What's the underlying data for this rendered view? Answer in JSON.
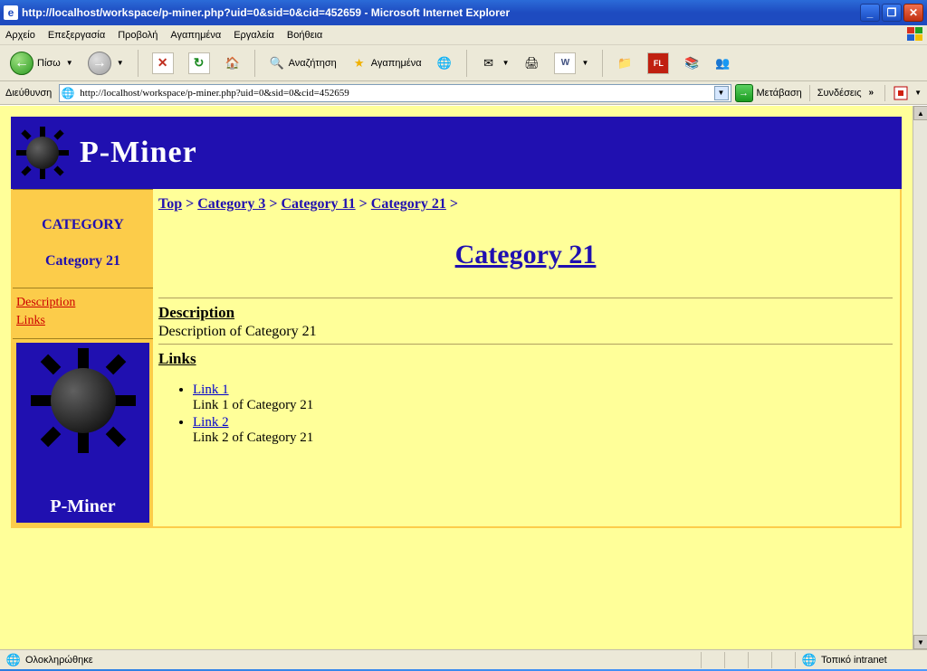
{
  "window": {
    "title": "http://localhost/workspace/p-miner.php?uid=0&sid=0&cid=452659 - Microsoft Internet Explorer"
  },
  "menu": {
    "items": [
      "Αρχείο",
      "Επεξεργασία",
      "Προβολή",
      "Αγαπημένα",
      "Εργαλεία",
      "Βοήθεια"
    ]
  },
  "toolbar": {
    "back_label": "Πίσω",
    "search_label": "Αναζήτηση",
    "favorites_label": "Αγαπημένα"
  },
  "address": {
    "label": "Διεύθυνση",
    "url": "http://localhost/workspace/p-miner.php?uid=0&sid=0&cid=452659",
    "go_label": "Μετάβαση",
    "links_label": "Συνδέσεις"
  },
  "page": {
    "brand": "P-Miner",
    "sidebar": {
      "category_label": "CATEGORY",
      "current_category": "Category 21",
      "nav": {
        "description": "Description",
        "links": "Links"
      },
      "footer_brand": "P-Miner"
    },
    "breadcrumb": {
      "items": [
        "Top",
        "Category 3",
        "Category 11",
        "Category 21"
      ],
      "sep": " > "
    },
    "heading": "Category 21",
    "description": {
      "title": "Description",
      "text": "Description of Category 21"
    },
    "links": {
      "title": "Links",
      "items": [
        {
          "label": "Link 1",
          "desc": "Link 1 of Category 21"
        },
        {
          "label": "Link 2",
          "desc": "Link 2 of Category 21"
        }
      ]
    }
  },
  "status": {
    "done": "Ολοκληρώθηκε",
    "zone": "Τοπικό intranet"
  }
}
